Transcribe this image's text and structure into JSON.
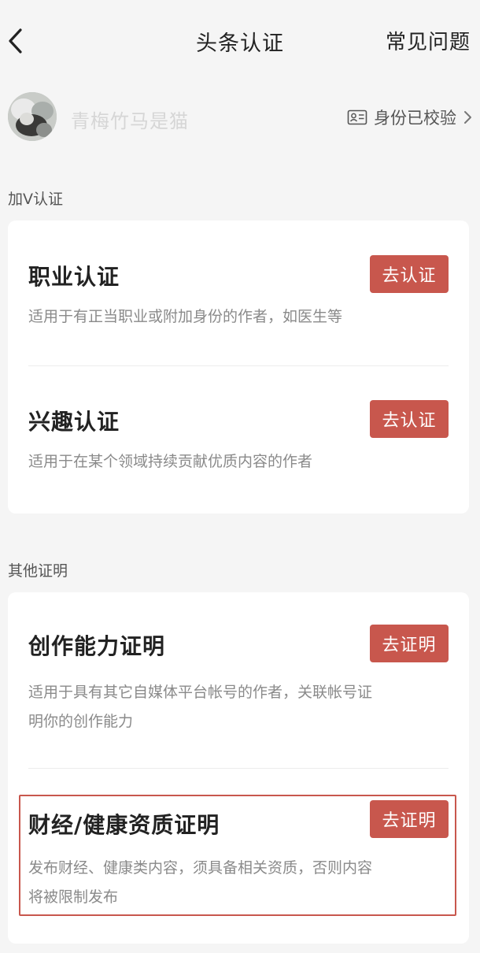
{
  "header": {
    "title": "头条认证",
    "faq": "常见问题"
  },
  "profile": {
    "username": "青梅竹马是猫",
    "verified": "身份已校验"
  },
  "sections": [
    {
      "label": "加V认证",
      "items": [
        {
          "title": "职业认证",
          "desc": "适用于有正当职业或附加身份的作者，如医生等",
          "button": "去认证"
        },
        {
          "title": "兴趣认证",
          "desc": "适用于在某个领域持续贡献优质内容的作者",
          "button": "去认证"
        }
      ]
    },
    {
      "label": "其他证明",
      "items": [
        {
          "title": "创作能力证明",
          "desc_lines": [
            "适用于具有其它自媒体平台帐号的作者，关联帐号证",
            "明你的创作能力"
          ],
          "button": "去证明"
        },
        {
          "title": "财经/健康资质证明",
          "desc_lines": [
            "发布财经、健康类内容，须具备相关资质，否则内容",
            "将被限制发布"
          ],
          "button": "去证明"
        }
      ]
    }
  ],
  "colors": {
    "accent": "#c8574d",
    "background": "#f5f5f5"
  },
  "icons": {
    "back": "back-arrow-icon",
    "id_card": "id-card-icon",
    "chevron": "chevron-right-icon"
  }
}
